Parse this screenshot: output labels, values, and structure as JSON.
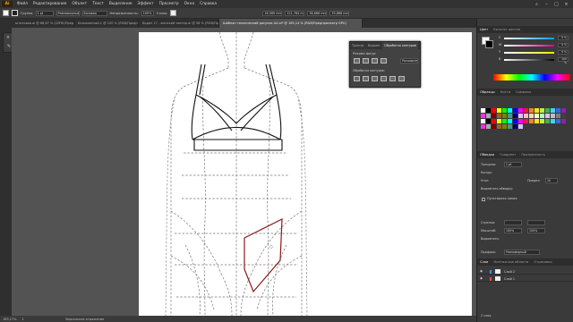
{
  "menubar": {
    "logo": "Ai",
    "items": [
      "Файл",
      "Редактирование",
      "Объект",
      "Текст",
      "Выделение",
      "Эффект",
      "Просмотр",
      "Окно",
      "Справка"
    ]
  },
  "control": {
    "group_label": "Группа",
    "stroke_value": "1 pt",
    "stroke_profile": "Равномерный",
    "brush_label": "Базовая",
    "opacity_label": "Непрозрачность:",
    "opacity_value": "100%",
    "style_label": "Стиль:",
    "x_value": "16,569 mm",
    "y_value": "121,784 mm",
    "w_value": "36,666 mm",
    "h_value": "39,868 mm"
  },
  "tabs": [
    "штатовая.ai @ 66,67 % (CMYK/Предпросмотр GPU)",
    "Безымянный-1 @ 100 % (RGB/Предпросмотр GPU)",
    "Бодиз 17 - женский светер.ai @ 58 % (RGB/Предпросмотр GPU)",
    "Шаблон технический рисунок А4.ai* @ 185,14 % (RGB/Предпросмотр GPU)"
  ],
  "status": {
    "zoom": "185,17%",
    "page": "1",
    "tool": "Зеркальное отражение"
  },
  "pathfinder": {
    "tabs": [
      "Трансф.",
      "Выравн.",
      "Обработка контуров"
    ],
    "shape_modes": "Режимы фигур:",
    "expand": "Расширить",
    "pathfinders": "Обработка контуров:"
  },
  "color_panel": {
    "tabs": [
      "Цвет",
      "Каталог цветов"
    ],
    "channels": [
      {
        "name": "C",
        "value": "0 %",
        "color": "#00a0e6"
      },
      {
        "name": "M",
        "value": "0 %",
        "color": "#e6007e"
      },
      {
        "name": "Y",
        "value": "0 %",
        "color": "#ffe600"
      },
      {
        "name": "K",
        "value": "100 %",
        "color": "#000000"
      }
    ]
  },
  "swatches_panel": {
    "tabs": [
      "Образцы",
      "Кисти",
      "Символы"
    ]
  },
  "stroke_panel": {
    "tabs": [
      "Обводка",
      "Градиент",
      "Прозрачность"
    ],
    "weight_label": "Толщина:",
    "weight_value": "1 pt",
    "cap_label": "Концы:",
    "corner_label": "Угол:",
    "limit_label": "Предел:",
    "limit_value": "10",
    "align_label": "Выровнять обводку:",
    "dashed_label": "Пунктирная линия",
    "arrows_label": "Стрелки:",
    "scale_label": "Масштаб:",
    "scale_value_1": "100%",
    "scale_value_2": "100%",
    "align_arrows_label": "Выровнять:",
    "profile_label": "Профиль:",
    "profile_value": "Равномерный"
  },
  "layers_panel": {
    "tabs": [
      "Слои",
      "Монтажные области",
      "Отрисовка"
    ],
    "layers": [
      {
        "name": "Слой 2",
        "color": "#4a8cff"
      },
      {
        "name": "Слой 1",
        "color": "#ff4a4a"
      }
    ],
    "footer": "2 слоя"
  }
}
